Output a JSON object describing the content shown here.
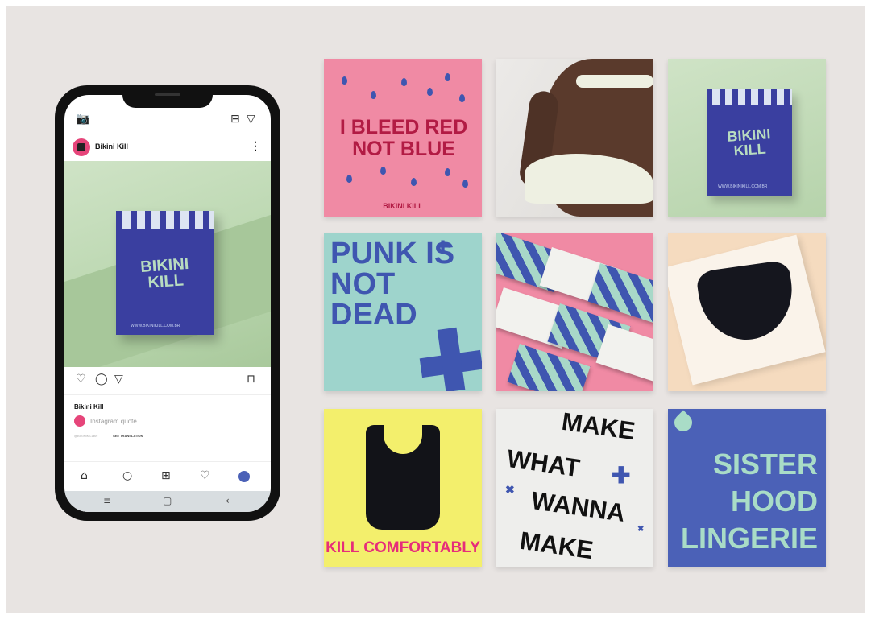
{
  "phone": {
    "profile_name": "Bikini Kill",
    "post_box_logo": "BIKINI KILL",
    "post_box_url": "WWW.BIKINIKILL.COM.BR",
    "caption_name": "Bikini Kill",
    "caption_quote": "Instagram quote",
    "caption_small": "@BIKINIKILLBR",
    "see_translation": "SEE TRANSLATION",
    "icons": {
      "camera": "📷",
      "direct": "▽",
      "igtv": "⊟",
      "more": "⋮",
      "like": "♡",
      "comment": "◯",
      "share": "▽",
      "save": "⊓",
      "home": "⌂",
      "search": "○",
      "add": "⊞",
      "activity": "♡",
      "nav_menu": "≡",
      "nav_home": "▢",
      "nav_back": "‹"
    }
  },
  "tiles": {
    "t1_text": "I BLEED RED NOT BLUE",
    "t1_small": "BIKINI KILL",
    "t3_logo": "BIKINI KILL",
    "t3_url": "WWW.BIKINIKILL.COM.BR",
    "t4_text": "PUNK IS NOT DEAD",
    "t7_text": "KILL COMFORTABLY",
    "t8_line1": "MAKE",
    "t8_line2": "WHAT",
    "t8_line3": "WANNA",
    "t8_line4": "MAKE",
    "t9_line1": "SISTER",
    "t9_line2": "HOOD",
    "t9_line3": "LINGERIE"
  },
  "colors": {
    "pink": "#f08aa4",
    "crimson": "#b21b44",
    "blue": "#3f56b0",
    "mint": "#9ed4cc",
    "yellow": "#f3ef6c",
    "magenta": "#e62d7a"
  }
}
